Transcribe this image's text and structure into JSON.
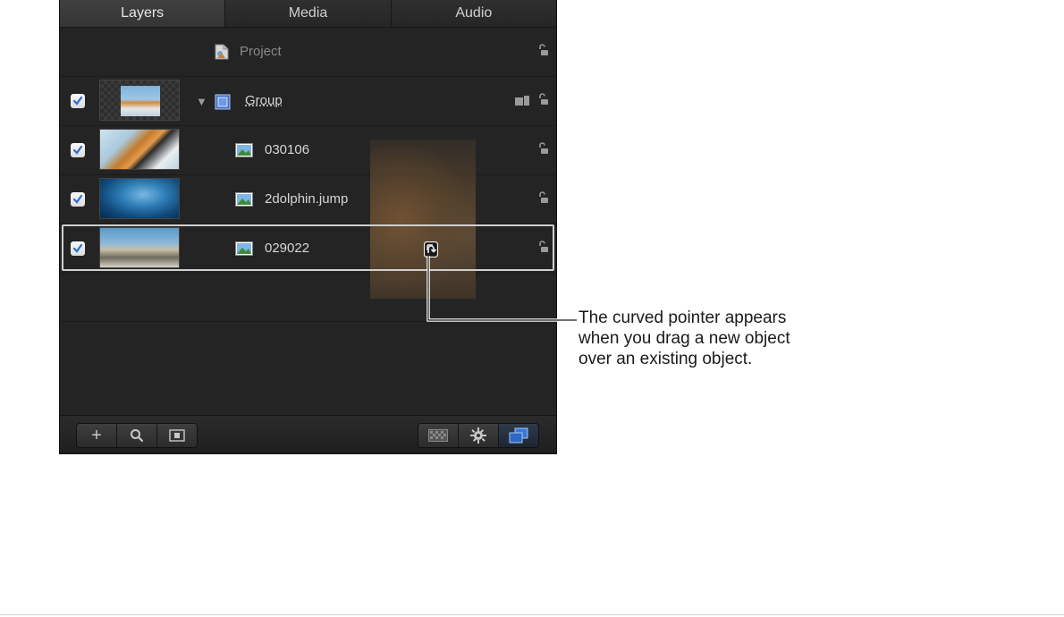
{
  "tabs": [
    {
      "label": "Layers",
      "active": true
    },
    {
      "label": "Media",
      "active": false
    },
    {
      "label": "Audio",
      "active": false
    }
  ],
  "layers": {
    "project": {
      "label": "Project",
      "icon": "project-icon",
      "locked": false
    },
    "group": {
      "label": "Group",
      "enabled": true,
      "expanded": true,
      "icon": "group-icon",
      "locked": false
    },
    "items": [
      {
        "label": "030106",
        "enabled": true,
        "icon": "image-layer-icon",
        "locked": false
      },
      {
        "label": "2dolphin.jump",
        "enabled": true,
        "icon": "image-layer-icon",
        "locked": false
      },
      {
        "label": "029022",
        "enabled": true,
        "icon": "image-layer-icon",
        "locked": false,
        "drop_target": true
      }
    ]
  },
  "drag": {
    "object": "lion-image",
    "cursor": "curved-pointer-icon"
  },
  "toolbar": {
    "left_buttons": [
      "add-icon",
      "search-icon",
      "isolate-icon"
    ],
    "right_buttons": [
      "checkerboard-icon",
      "gear-icon",
      "layers-view-icon"
    ],
    "selected_right": "layers-view-icon"
  },
  "annotation": {
    "text": "The curved pointer appears when you drag a new object over an existing object."
  },
  "colors": {
    "panel_bg": "#242424",
    "accent": "#3a78d8",
    "frame": "#cfcfcf"
  }
}
